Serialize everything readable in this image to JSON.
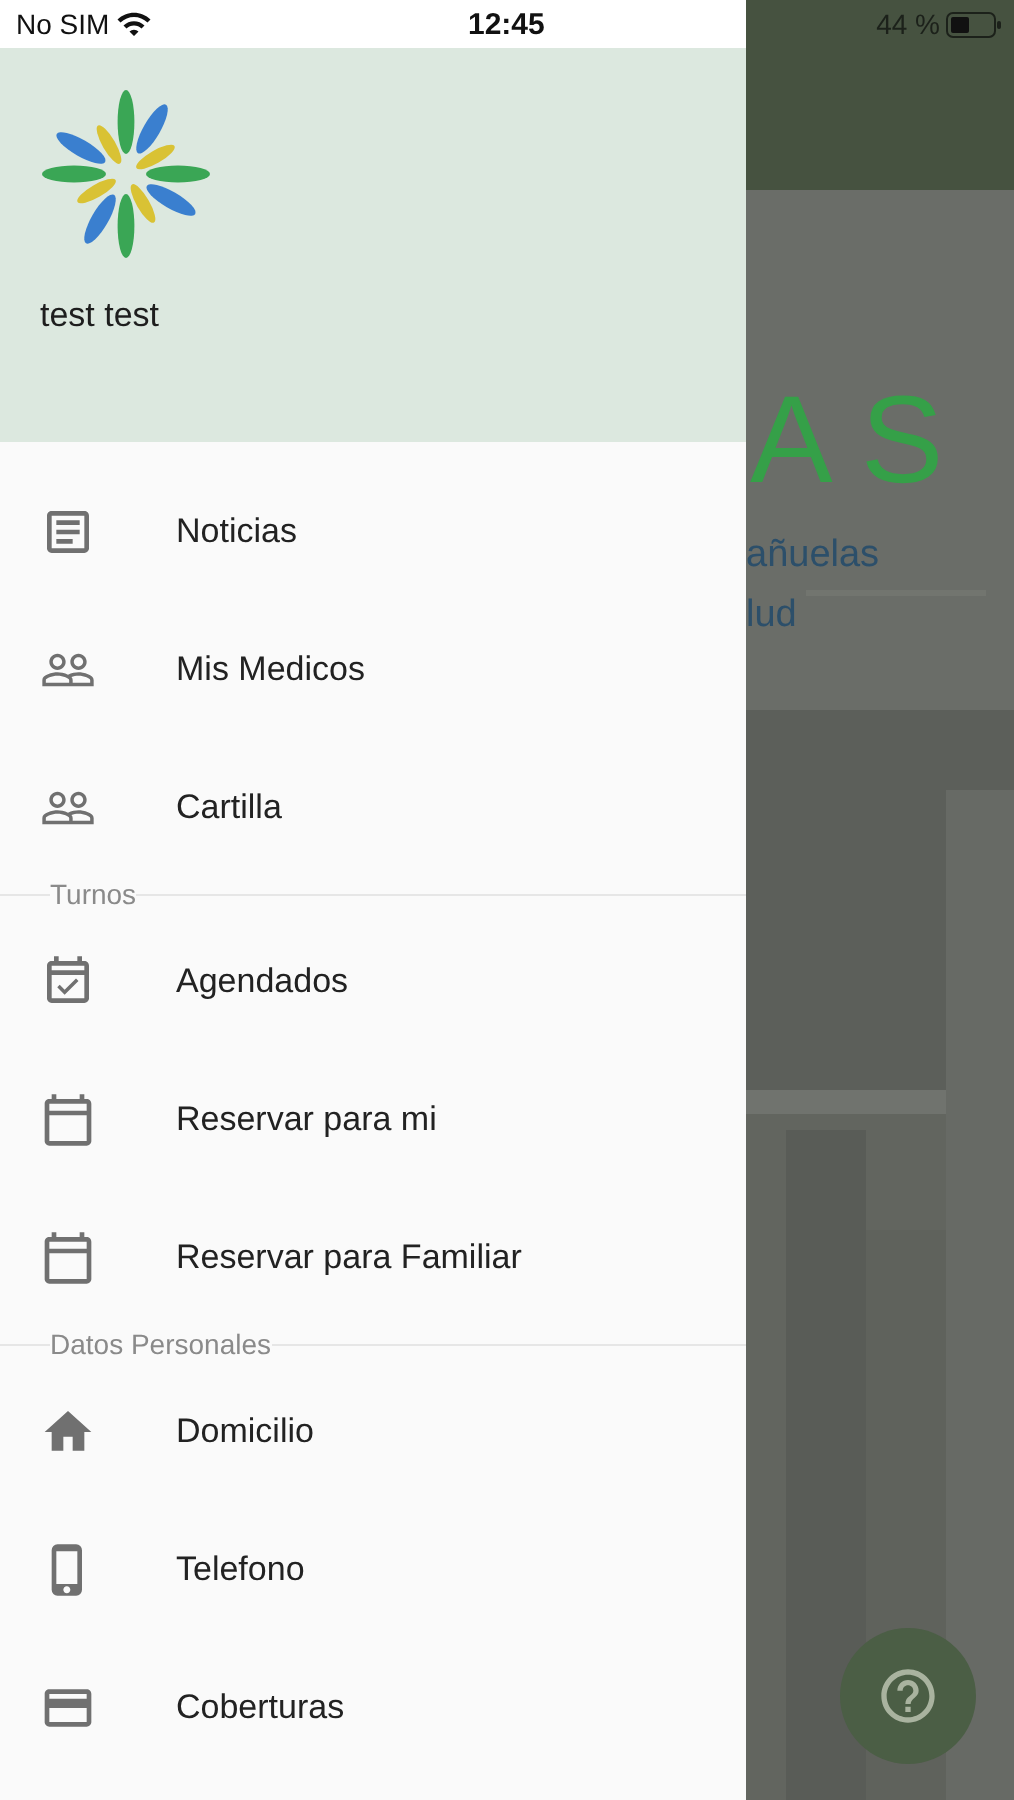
{
  "status_bar": {
    "carrier": "No SIM",
    "time": "12:45",
    "battery": "44 %"
  },
  "drawer": {
    "user_name": "test test",
    "sections": [
      {
        "items": [
          {
            "label": "Noticias",
            "kind": "news"
          },
          {
            "label": "Mis Medicos",
            "kind": "people"
          },
          {
            "label": "Cartilla",
            "kind": "people"
          }
        ]
      },
      {
        "title": "Turnos",
        "items": [
          {
            "label": "Agendados",
            "kind": "calendar_check"
          },
          {
            "label": "Reservar para mi",
            "kind": "calendar"
          },
          {
            "label": "Reservar para Familiar",
            "kind": "calendar"
          }
        ]
      },
      {
        "title": "Datos Personales",
        "items": [
          {
            "label": "Domicilio",
            "kind": "home"
          },
          {
            "label": "Telefono",
            "kind": "phone"
          },
          {
            "label": "Coberturas",
            "kind": "card"
          }
        ]
      }
    ]
  },
  "background_page": {
    "heading": "AS",
    "lines": [
      "añuelas",
      "lud"
    ],
    "help_button": {
      "kind": "help"
    }
  }
}
